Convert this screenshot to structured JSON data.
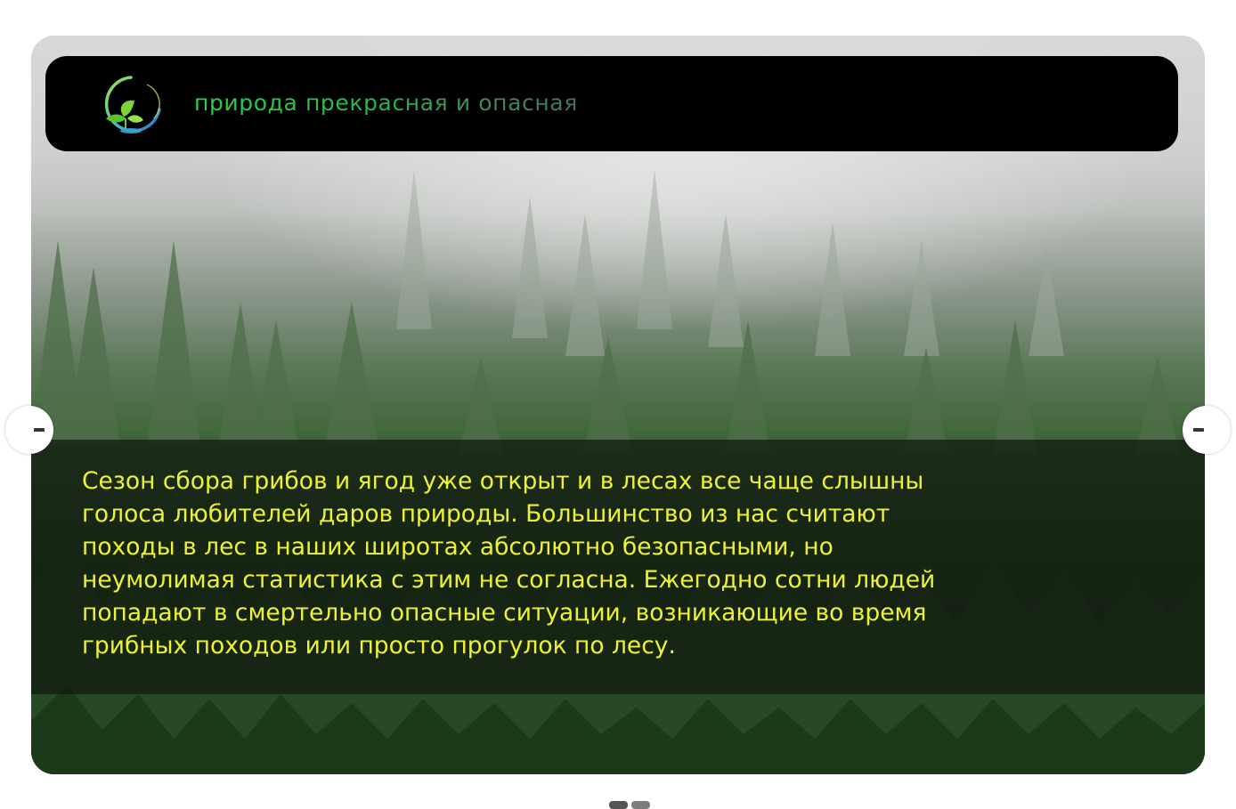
{
  "site": {
    "title": "природа прекрасная и опасная",
    "logo_icon": "leaf-moon-logo"
  },
  "slide": {
    "text": "Сезон сбора грибов и ягод уже открыт и в лесах все чаще слышны голоса любителей даров природы. Большинство из нас считают походы в лес в наших широтах абсолютно безопасными, но неумолимая статистика с этим не согласна. Ежегодно сотни людей попадают в смертельно опасные ситуации, возникающие во время грибных походов или просто прогулок по лесу."
  },
  "navigation": {
    "prev_icon": "arrow-left-icon",
    "next_icon": "arrow-right-icon",
    "slides_total": 2,
    "current_slide": 1
  },
  "colors": {
    "caption_text": "#eef232",
    "title_green": "#2bd24a",
    "header_bg": "#000000"
  }
}
